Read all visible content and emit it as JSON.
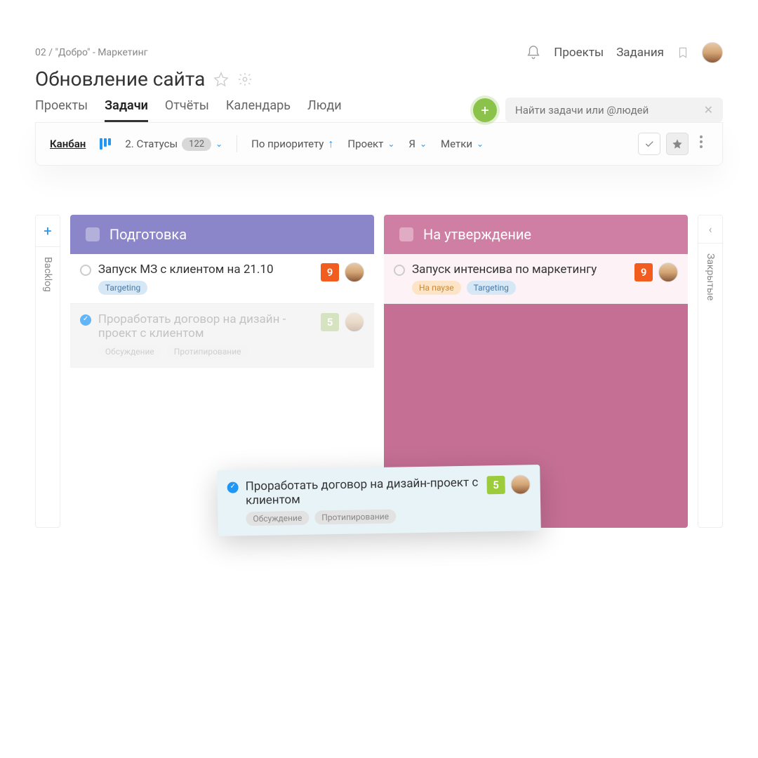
{
  "breadcrumb": "02 / \"Добро\" - Маркетинг",
  "header_nav": {
    "projects": "Проекты",
    "tasks": "Задания"
  },
  "title": "Обновление сайта",
  "tabs": {
    "projects": "Проекты",
    "tasks": "Задачи",
    "reports": "Отчёты",
    "calendar": "Календарь",
    "people": "Люди"
  },
  "search": {
    "placeholder": "Найти задачи или @людей"
  },
  "toolbar": {
    "kanban": "Канбан",
    "statuses": "2. Статусы",
    "count": "122",
    "priority": "По приоритету",
    "project": "Проект",
    "me": "Я",
    "labels": "Метки"
  },
  "side_left": {
    "label": "Backlog"
  },
  "side_right": {
    "label": "Закрытые"
  },
  "columns": [
    {
      "title": "Подготовка",
      "cards": [
        {
          "title": "Запуск МЗ с клиентом на 21.10",
          "tags": [
            "Targeting"
          ],
          "score": "9"
        },
        {
          "title": "Проработать договор на дизайн - проект с клиентом",
          "tags": [
            "Обсуждение",
            "Протипирование"
          ],
          "score": "5"
        }
      ]
    },
    {
      "title": "На утверждение",
      "cards": [
        {
          "title": "Запуск интенсива по маркетингу",
          "tags": [
            "На паузе",
            "Targeting"
          ],
          "score": "9"
        }
      ]
    }
  ],
  "floating": {
    "title": "Проработать договор на дизайн-проект с клиентом",
    "tags": [
      "Обсуждение",
      "Протипирование"
    ],
    "score": "5"
  }
}
